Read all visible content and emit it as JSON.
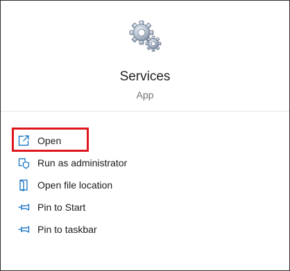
{
  "app": {
    "name": "Services",
    "type": "App",
    "icon": "gears-icon"
  },
  "menu": {
    "items": [
      {
        "label": "Open",
        "icon": "open-external-icon"
      },
      {
        "label": "Run as administrator",
        "icon": "shield-icon"
      },
      {
        "label": "Open file location",
        "icon": "file-location-icon"
      },
      {
        "label": "Pin to Start",
        "icon": "pin-icon"
      },
      {
        "label": "Pin to taskbar",
        "icon": "pin-icon"
      }
    ]
  },
  "colors": {
    "accent_icon": "#0067c0",
    "highlight": "#e0161f"
  }
}
